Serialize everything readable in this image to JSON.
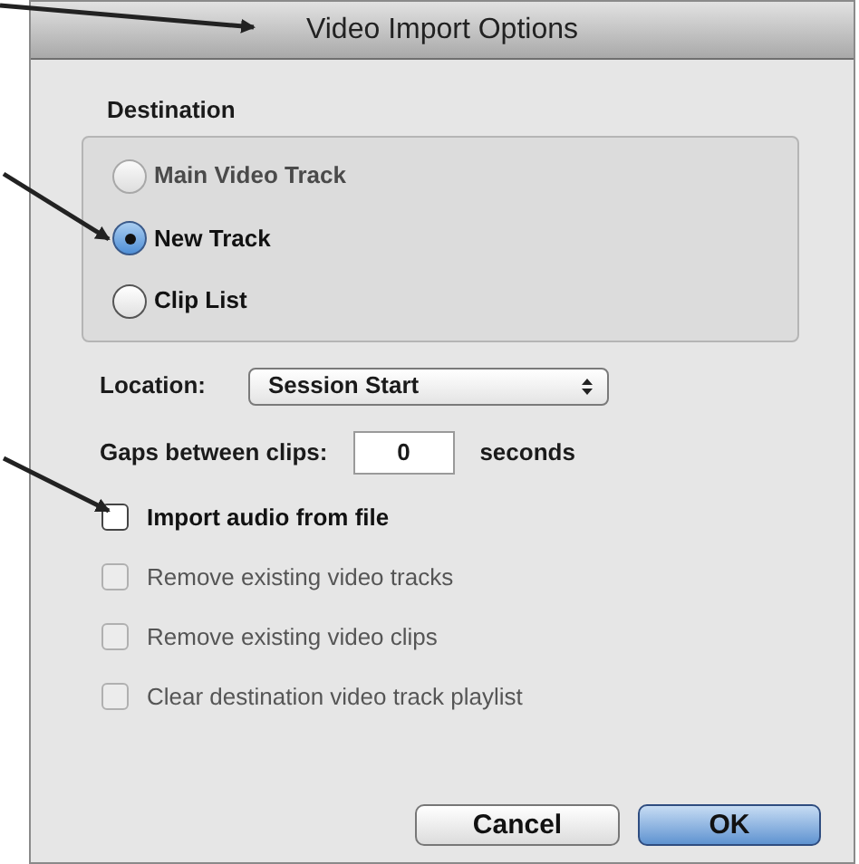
{
  "window": {
    "title": "Video Import Options"
  },
  "destination": {
    "label": "Destination",
    "options": [
      {
        "label": "Main Video Track",
        "selected": false,
        "disabled": true
      },
      {
        "label": "New Track",
        "selected": true,
        "disabled": false
      },
      {
        "label": "Clip List",
        "selected": false,
        "disabled": false
      }
    ]
  },
  "location": {
    "label": "Location:",
    "value": "Session Start"
  },
  "gaps": {
    "label": "Gaps between clips:",
    "value": "0",
    "unit": "seconds"
  },
  "options": [
    {
      "label": "Import audio from file",
      "checked": false,
      "disabled": false
    },
    {
      "label": "Remove existing video tracks",
      "checked": false,
      "disabled": true
    },
    {
      "label": "Remove existing video clips",
      "checked": false,
      "disabled": true
    },
    {
      "label": "Clear destination video track playlist",
      "checked": false,
      "disabled": true
    }
  ],
  "buttons": [
    {
      "label": "Cancel",
      "default": false
    },
    {
      "label": "OK",
      "default": true
    }
  ]
}
